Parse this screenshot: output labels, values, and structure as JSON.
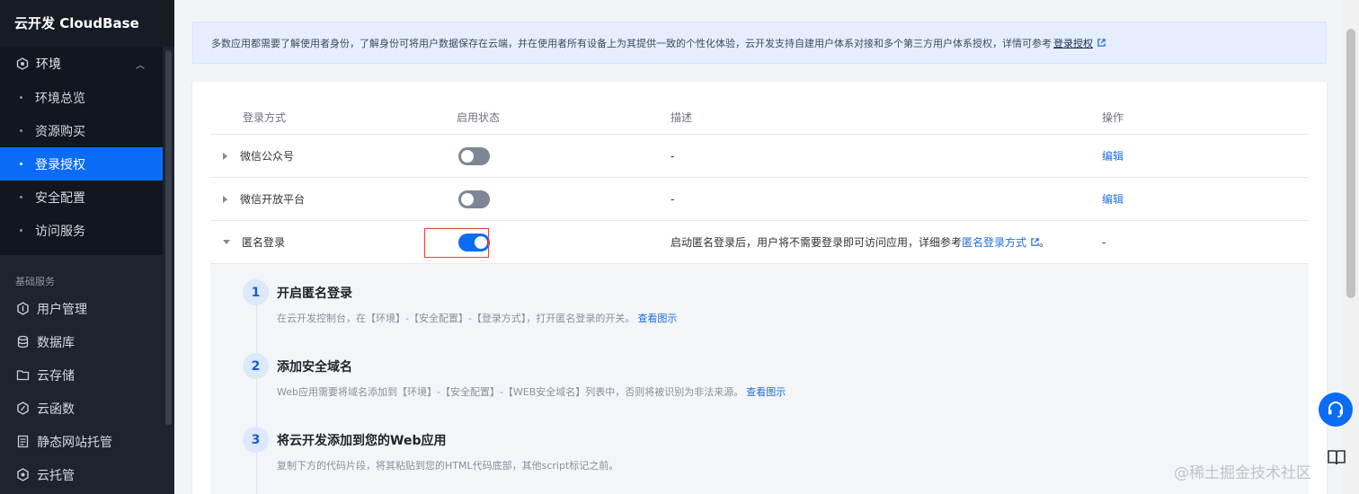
{
  "sidebar": {
    "brand": "云开发 CloudBase",
    "group": {
      "label": "环境",
      "children": [
        {
          "label": "环境总览"
        },
        {
          "label": "资源购买"
        },
        {
          "label": "登录授权"
        },
        {
          "label": "安全配置"
        },
        {
          "label": "访问服务"
        }
      ]
    },
    "section_title": "基础服务",
    "items": [
      {
        "label": "用户管理",
        "icon": "user-management-icon"
      },
      {
        "label": "数据库",
        "icon": "database-icon"
      },
      {
        "label": "云存储",
        "icon": "folder-icon"
      },
      {
        "label": "云函数",
        "icon": "function-icon"
      },
      {
        "label": "静态网站托管",
        "icon": "document-icon"
      },
      {
        "label": "云托管",
        "icon": "hexagon-icon"
      }
    ]
  },
  "banner": {
    "text": "多数应用都需要了解使用者身份，了解身份可将用户数据保存在云端，并在使用者所有设备上为其提供一致的个性化体验，云开发支持自建用户体系对接和多个第三方用户体系授权，详情可参考",
    "link": "登录授权"
  },
  "table": {
    "headers": {
      "method": "登录方式",
      "status": "启用状态",
      "desc": "描述",
      "ops": "操作"
    },
    "rows": [
      {
        "name": "微信公众号",
        "enabled": false,
        "desc": "-",
        "op": "编辑"
      },
      {
        "name": "微信开放平台",
        "enabled": false,
        "desc": "-",
        "op": "编辑"
      },
      {
        "name": "匿名登录",
        "enabled": true,
        "desc": "启动匿名登录后，用户将不需要登录即可访问应用，详细参考",
        "desc_link": "匿名登录方式",
        "desc_suffix": "。",
        "op": "-"
      }
    ]
  },
  "steps": [
    {
      "num": "1",
      "title": "开启匿名登录",
      "desc": "在云开发控制台，在【环境】-【安全配置】-【登录方式】，打开匿名登录的开关。",
      "link": "查看图示"
    },
    {
      "num": "2",
      "title": "添加安全域名",
      "desc": "Web应用需要将域名添加到【环境】-【安全配置】-【WEB安全域名】列表中，否则将被识别为非法来源。",
      "link": "查看图示"
    },
    {
      "num": "3",
      "title": "将云开发添加到您的Web应用",
      "desc": "复制下方的代码片段，将其粘贴到您的HTML代码底部，其他script标记之前。",
      "link": ""
    }
  ],
  "watermark": "@稀土掘金技术社区",
  "colors": {
    "accent": "#0a6cf5",
    "sidebar": "#1d232f",
    "highlight": "#e0443e"
  }
}
